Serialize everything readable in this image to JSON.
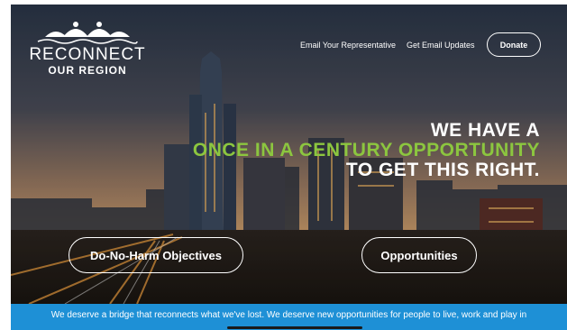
{
  "logo": {
    "line1": "RECONNECT",
    "line2": "OUR REGION"
  },
  "nav": {
    "link1": "Email Your Representative",
    "link2": "Get Email Updates",
    "donate": "Donate"
  },
  "hero": {
    "line1": "WE HAVE A",
    "line2": "ONCE IN A CENTURY OPPORTUNITY",
    "line3": "TO GET THIS RIGHT.",
    "button_left": "Do-No-Harm Objectives",
    "button_right": "Opportunities"
  },
  "banner": {
    "text": "We deserve a bridge that reconnects what we've lost. We deserve new opportunities for people to live, work and play in"
  },
  "colors": {
    "accent_green": "#8cc63f",
    "banner_blue": "#1e90d6"
  }
}
